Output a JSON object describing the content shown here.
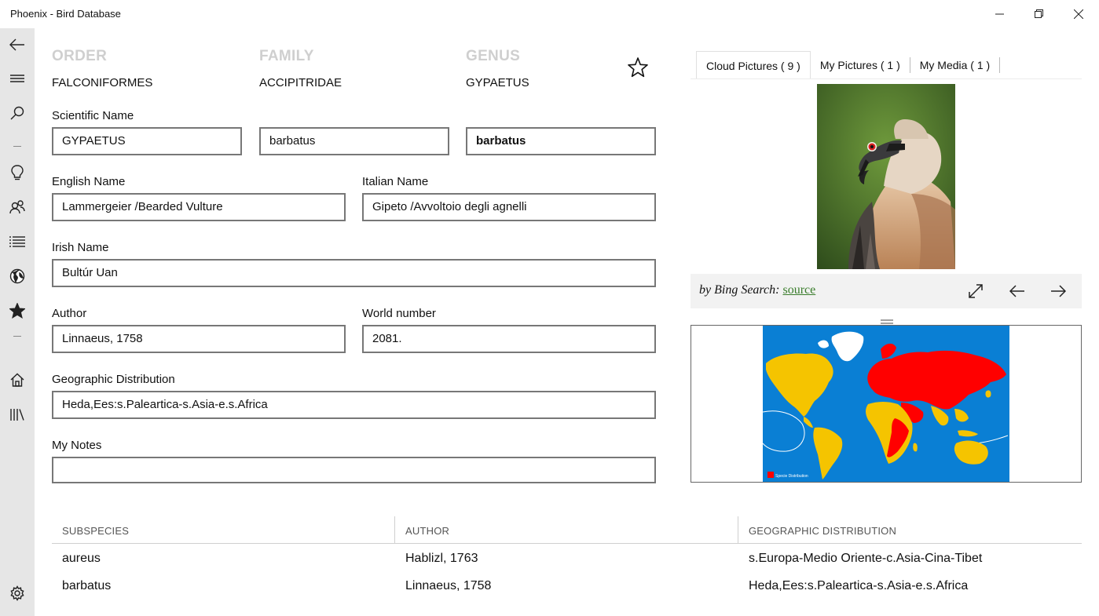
{
  "window": {
    "title": "Phoenix - Bird Database"
  },
  "taxonomy": {
    "order_label": "ORDER",
    "order_value": "FALCONIFORMES",
    "family_label": "FAMILY",
    "family_value": "ACCIPITRIDAE",
    "genus_label": "GENUS",
    "genus_value": "GYPAETUS"
  },
  "form": {
    "scientific_name_label": "Scientific Name",
    "scientific_genus": "GYPAETUS",
    "scientific_species": "barbatus",
    "scientific_subspecies": "barbatus",
    "english_name_label": "English Name",
    "english_name": "Lammergeier /Bearded Vulture",
    "italian_name_label": "Italian Name",
    "italian_name": "Gipeto /Avvoltoio degli agnelli",
    "irish_name_label": "Irish Name",
    "irish_name": "Bultúr Uan",
    "author_label": "Author",
    "author": "Linnaeus, 1758",
    "world_number_label": "World number",
    "world_number": "2081.",
    "geo_label": "Geographic Distribution",
    "geo": "Heda,Ees:s.Paleartica-s.Asia-e.s.Africa",
    "notes_label": "My Notes",
    "notes": ""
  },
  "media": {
    "tabs": [
      {
        "label": "Cloud Pictures ( 9 )"
      },
      {
        "label": "My Pictures ( 1 )"
      },
      {
        "label": "My Media ( 1 )"
      }
    ],
    "caption_prefix": "by Bing Search:",
    "caption_link": "source",
    "map_legend": "Specie Distribution"
  },
  "subspecies_table": {
    "headers": [
      "SUBSPECIES",
      "AUTHOR",
      "GEOGRAPHIC DISTRIBUTION"
    ],
    "rows": [
      [
        "aureus",
        "Hablizl, 1763",
        "s.Europa-Medio Oriente-c.Asia-Cina-Tibet"
      ],
      [
        "barbatus",
        "Linnaeus, 1758",
        "Heda,Ees:s.Paleartica-s.Asia-e.s.Africa"
      ]
    ]
  },
  "colors": {
    "rail_bg": "#e6e6e6",
    "map_ocean": "#0a7fd4",
    "map_land": "#f5c400",
    "map_distribution": "#ff0000",
    "link": "#3a7d2c"
  },
  "icons": {
    "rail": [
      "back-arrow-icon",
      "hamburger-icon",
      "search-icon",
      "lightbulb-icon",
      "people-icon",
      "list-icon",
      "globe-icon",
      "star-icon",
      "home-icon",
      "library-icon",
      "gear-icon"
    ],
    "favorite": "star-outline-icon",
    "caption": [
      "expand-icon",
      "arrow-left-icon",
      "arrow-right-icon"
    ]
  }
}
